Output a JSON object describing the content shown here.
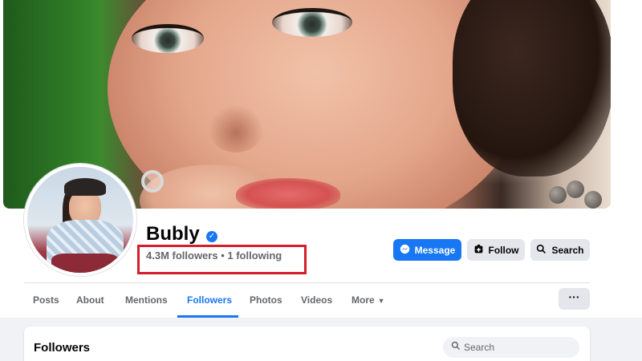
{
  "profile": {
    "name": "Bubly",
    "verified_mark": "✓",
    "stats": "4.3M followers • 1 following"
  },
  "actions": {
    "message": "Message",
    "follow": "Follow",
    "search": "Search"
  },
  "icons": {
    "messenger": "messenger-icon",
    "follow": "follow-icon",
    "search": "search-icon",
    "more_menu": "ellipsis-icon"
  },
  "tabs": [
    {
      "label": "Posts"
    },
    {
      "label": "About"
    },
    {
      "label": "Mentions"
    },
    {
      "label": "Followers",
      "active": true
    },
    {
      "label": "Photos"
    },
    {
      "label": "Videos"
    },
    {
      "label": "More"
    }
  ],
  "ellipsis": "···",
  "followers_section": {
    "title": "Followers",
    "search_placeholder": "Search"
  },
  "colors": {
    "accent": "#1877f2",
    "highlight_box": "#d31f2a"
  }
}
